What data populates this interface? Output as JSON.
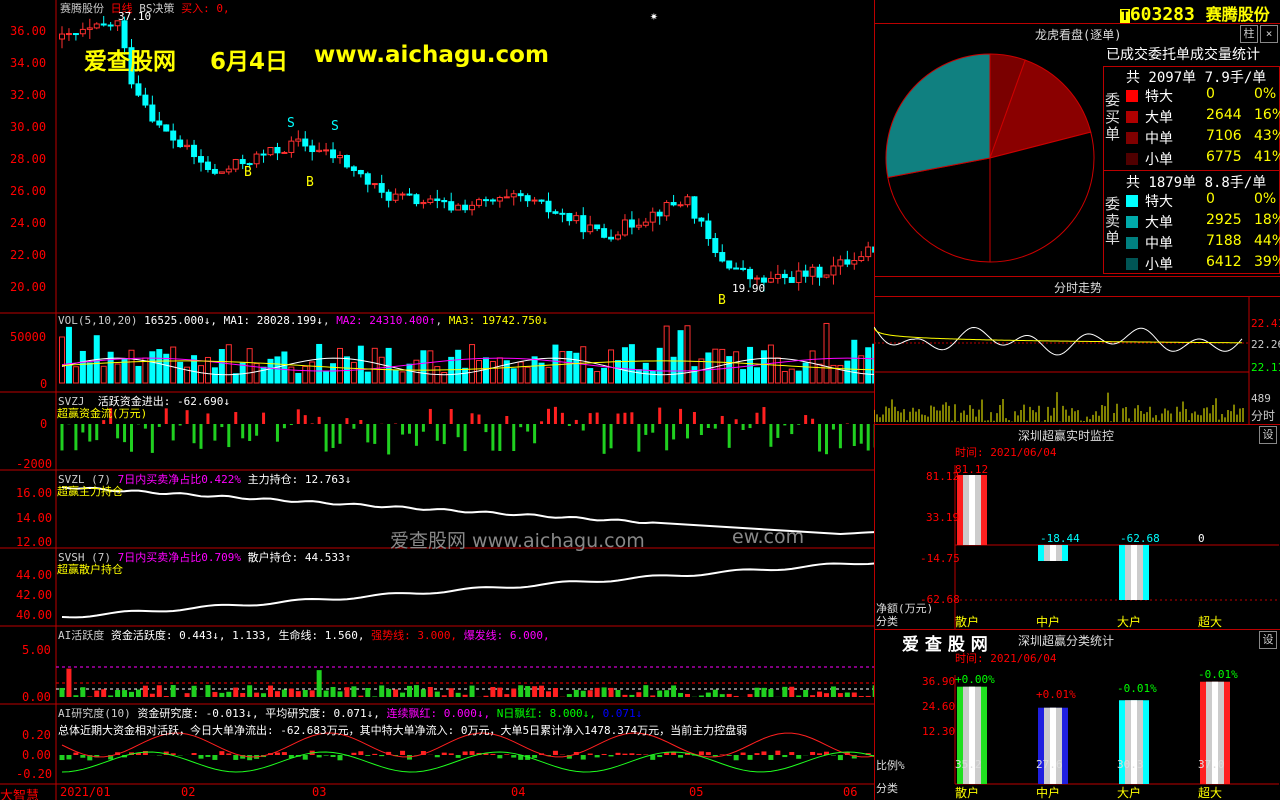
{
  "stock": {
    "name": "赛腾股份",
    "period": "日线",
    "strategy": "BS决策",
    "buy_label": "买入: 0,",
    "high_marker": "37.10",
    "low_marker": "19.90",
    "buy_mark": "B",
    "sell_mark": "S",
    "code": "603283",
    "tag": "T"
  },
  "watermark": {
    "site": "爱查股网",
    "date": "6月4日",
    "url": "www.aichagu.com",
    "mid": "爱查股网    www.aichagu.com",
    "mid2": "ew.com"
  },
  "price_axis": [
    "36.00",
    "34.00",
    "32.00",
    "30.00",
    "28.00",
    "26.00",
    "24.00",
    "22.00",
    "20.00"
  ],
  "vol": {
    "title": "VOL(5,10,20)",
    "v": "16525.000↓",
    "ma1": "MA1: 28028.199↓",
    "ma2": "MA2: 24310.400↑",
    "ma3": "MA3: 19742.750↓",
    "axis": [
      "50000",
      "0"
    ]
  },
  "svzj": {
    "title": "SVZJ",
    "l1": "活跃资金进出: -62.690↓",
    "l2": "超赢资金流(万元)",
    "axis": [
      "0",
      "-2000"
    ]
  },
  "svzl": {
    "title": "SVZL (7)",
    "l1": "7日内买卖净占比0.422%",
    "l2": "主力持仓: 12.763↓",
    "l3": "超赢主力持仓",
    "axis": [
      "16.00",
      "14.00",
      "12.00"
    ]
  },
  "svsh": {
    "title": "SVSH (7)",
    "l1": "7日内买卖净占比0.709%",
    "l2": "散户持仓: 44.533↑",
    "l3": "超赢散户持仓",
    "axis": [
      "44.00",
      "42.00",
      "40.00"
    ]
  },
  "ai": {
    "title": "AI活跃度",
    "l1": "资金活跃度: 0.443↓, 1.133,",
    "l2": "生命线: 1.560,",
    "l3": "强势线: 3.000,",
    "l4": "爆发线: 6.000,",
    "axis": [
      "5.00",
      "0.00"
    ]
  },
  "air": {
    "title": "AI研究度(10)",
    "l1": "资金研究度: -0.013↓,",
    "l2": "平均研究度: 0.071↓,",
    "l3": "连续飘红: 0.000↓,",
    "l4": "N日飘红: 8.000↓,",
    "l5": "0.071↓",
    "summary": "总体近期大资金相对活跃，今日大单净流出: -62.683万元，其中特大单净流入: 0万元，大单5日累计净入1478.374万元，当前主力控盘弱",
    "axis": [
      "0.20",
      "0.00",
      "-0.20"
    ]
  },
  "xaxis": [
    "2021/01",
    "02",
    "03",
    "04",
    "05",
    "06"
  ],
  "brand": "大智慧",
  "toolbar": {
    "pin": "柱",
    "close": "×"
  },
  "lh": {
    "title": "龙虎看盘(逐单)",
    "subtitle": "已成交委托单成交量统计",
    "buy_label": "委买单",
    "sell_label": "委卖单",
    "buy_total": "共 2097单 7.9手/单",
    "sell_total": "共 1879单 8.8手/单",
    "buy_rows": [
      {
        "name": "特大",
        "n": "0",
        "p": "0%",
        "color": "#ff0000"
      },
      {
        "name": "大单",
        "n": "2644",
        "p": "16%",
        "color": "#b00000"
      },
      {
        "name": "中单",
        "n": "7106",
        "p": "43%",
        "color": "#800000"
      },
      {
        "name": "小单",
        "n": "6775",
        "p": "41%",
        "color": "#500000"
      }
    ],
    "sell_rows": [
      {
        "name": "特大",
        "n": "0",
        "p": "0%",
        "color": "#00ffff"
      },
      {
        "name": "大单",
        "n": "2925",
        "p": "18%",
        "color": "#00aaaa"
      },
      {
        "name": "中单",
        "n": "7188",
        "p": "44%",
        "color": "#008080"
      },
      {
        "name": "小单",
        "n": "6412",
        "p": "39%",
        "color": "#005555"
      }
    ]
  },
  "fs": {
    "title": "分时走势",
    "axis": [
      "22.41",
      "22.26",
      "22.11"
    ],
    "vol": "489",
    "vol2": "分时"
  },
  "mon": {
    "title": "深圳超赢实时监控",
    "time": "时间: 2021/06/04",
    "set": "设",
    "axis": [
      "81.12",
      "33.19",
      "-14.75",
      "-62.68"
    ],
    "ylabel": "净额(万元)",
    "xlabel": "分类",
    "cats": [
      "散户",
      "中户",
      "大户",
      "超大"
    ],
    "vals": [
      "81.12",
      "-18.44",
      "-62.68",
      "0"
    ]
  },
  "cls": {
    "brand": "爱 查 股 网",
    "title": "深圳超赢分类统计",
    "time": "时间: 2021/06/04",
    "set": "设",
    "axis": [
      "36.90",
      "24.60",
      "12.30"
    ],
    "ylabel": "比例%",
    "xlabel": "分类",
    "cats": [
      "散户",
      "中户",
      "大户",
      "超大"
    ],
    "tops": [
      "+0.00%",
      "+0.01%",
      "-0.01%",
      "-0.01%"
    ],
    "vals": [
      "35.2",
      "27.6",
      "30.3",
      "37.0"
    ]
  }
}
